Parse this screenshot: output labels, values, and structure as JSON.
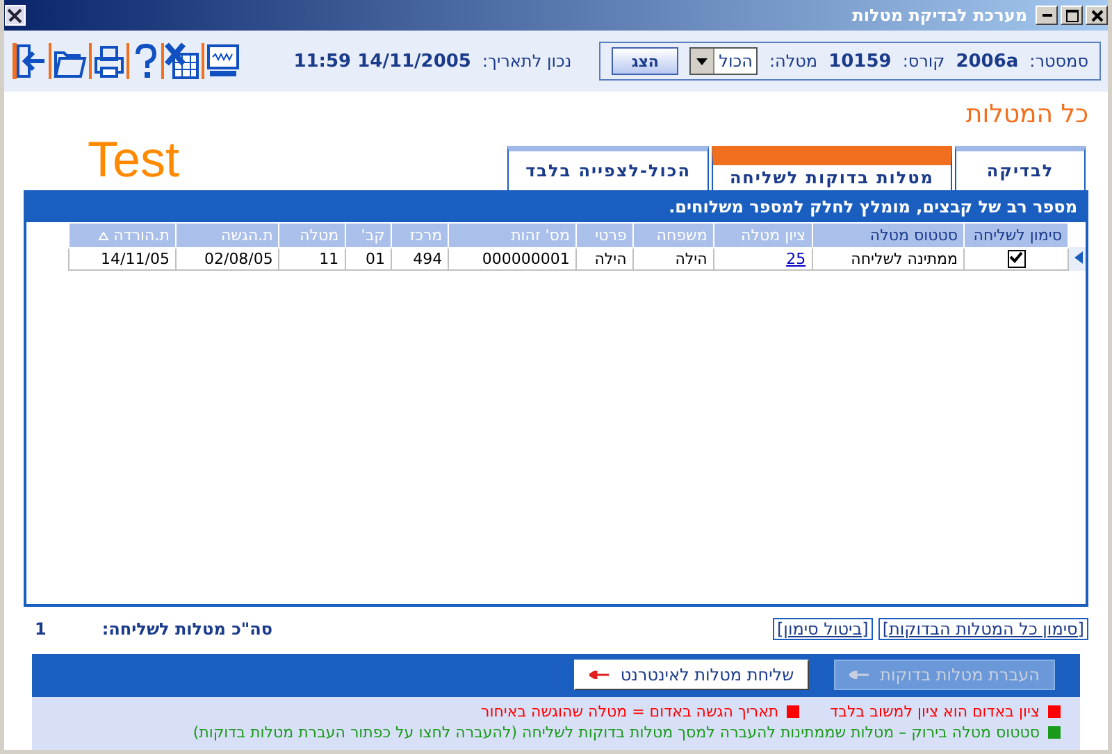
{
  "window": {
    "title": "מערכת לבדיקת מטלות"
  },
  "filters": {
    "semester_label": "סמסטר:",
    "semester": "2006a",
    "course_label": "קורס:",
    "course": "10159",
    "task_label": "מטלה:",
    "task": "הכול",
    "show_button": "הצג"
  },
  "date": {
    "label": "נכון לתאריך:",
    "value": "11:59 14/11/2005"
  },
  "page_title": "כל המטלות",
  "test_label": "Test",
  "tabs": [
    {
      "label": "לבדיקה",
      "selected": false
    },
    {
      "label": "מטלות בדוקות לשליחה",
      "selected": true
    },
    {
      "label": "הכול-לצפייה בלבד",
      "selected": false
    }
  ],
  "notice": "מספר רב של קבצים, מומלץ לחלק למספר משלוחים.",
  "table": {
    "check_column": "סימון לשליחה",
    "columns": [
      {
        "label": "סטטוס מטלה",
        "kind": "text",
        "sorted": false
      },
      {
        "label": "ציון מטלה",
        "kind": "link",
        "sorted": false
      },
      {
        "label": "משפחה",
        "kind": "text",
        "sorted": false
      },
      {
        "label": "פרטי",
        "kind": "text",
        "sorted": false
      },
      {
        "label": "מס' זהות",
        "kind": "text",
        "sorted": false
      },
      {
        "label": "מרכז",
        "kind": "text",
        "sorted": false
      },
      {
        "label": "קב'",
        "kind": "text",
        "sorted": false
      },
      {
        "label": "מטלה",
        "kind": "text",
        "sorted": false
      },
      {
        "label": "ת.הגשה",
        "kind": "text",
        "sorted": false
      },
      {
        "label": "ת.הורדה",
        "kind": "text",
        "sorted": true
      }
    ],
    "rows": [
      {
        "current": true,
        "checked": true,
        "cells": [
          "ממתינה לשליחה",
          "25",
          "הילה",
          "הילה",
          "000000001",
          "494",
          "01",
          "11",
          "02/08/05",
          "14/11/05"
        ]
      }
    ]
  },
  "links": [
    "[סימון כל המטלות הבדוקות]",
    "[ביטול סימון]"
  ],
  "total": {
    "label": "סה\"כ מטלות לשליחה:",
    "value": "1"
  },
  "buttons": [
    {
      "label": "העברת מטלות בדוקות",
      "disabled": true
    },
    {
      "label": "שליחת מטלות לאינטרנט",
      "disabled": false
    }
  ],
  "legend": [
    {
      "color": "#ff0000",
      "text": "ציון באדום הוא ציון למשוב בלבד"
    },
    {
      "color": "#ff0000",
      "text": "תאריך הגשה באדום = מטלה שהוגשה באיחור"
    },
    {
      "color": "#1a9a1a",
      "text": "סטטוס מטלה בירוק – מטלות שממתינות להעברה למסך מטלות בדוקות לשליחה (להעברה לחצו על כפתור העברת מטלות בדוקות)"
    }
  ]
}
